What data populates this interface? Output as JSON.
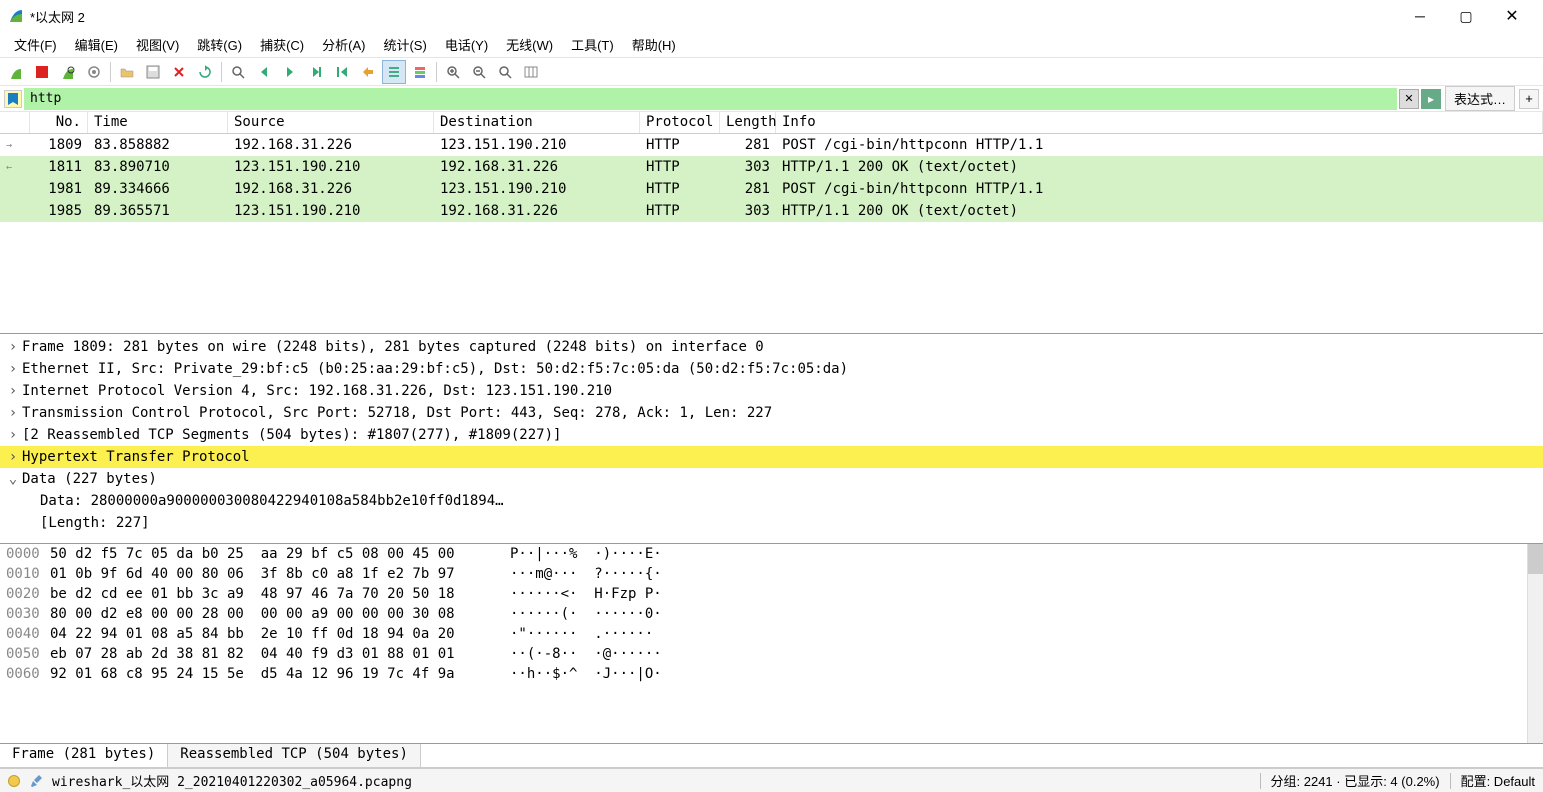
{
  "window": {
    "title": "*以太网 2"
  },
  "menu": {
    "file": "文件(F)",
    "edit": "编辑(E)",
    "view": "视图(V)",
    "go": "跳转(G)",
    "capture": "捕获(C)",
    "analyze": "分析(A)",
    "stats": "统计(S)",
    "telephony": "电话(Y)",
    "wireless": "无线(W)",
    "tools": "工具(T)",
    "help": "帮助(H)"
  },
  "filter": {
    "value": "http",
    "expression_btn": "表达式…",
    "plus_btn": "+"
  },
  "columns": {
    "no": "No.",
    "time": "Time",
    "src": "Source",
    "dst": "Destination",
    "proto": "Protocol",
    "len": "Length",
    "info": "Info"
  },
  "packets": [
    {
      "no": "1809",
      "time": "83.858882",
      "src": "192.168.31.226",
      "dst": "123.151.190.210",
      "proto": "HTTP",
      "len": "281",
      "info": "POST /cgi-bin/httpconn HTTP/1.1",
      "green": false,
      "mark": "→"
    },
    {
      "no": "1811",
      "time": "83.890710",
      "src": "123.151.190.210",
      "dst": "192.168.31.226",
      "proto": "HTTP",
      "len": "303",
      "info": "HTTP/1.1 200 OK  (text/octet)",
      "green": true,
      "mark": "←"
    },
    {
      "no": "1981",
      "time": "89.334666",
      "src": "192.168.31.226",
      "dst": "123.151.190.210",
      "proto": "HTTP",
      "len": "281",
      "info": "POST /cgi-bin/httpconn HTTP/1.1",
      "green": true,
      "mark": ""
    },
    {
      "no": "1985",
      "time": "89.365571",
      "src": "123.151.190.210",
      "dst": "192.168.31.226",
      "proto": "HTTP",
      "len": "303",
      "info": "HTTP/1.1 200 OK  (text/octet)",
      "green": true,
      "mark": ""
    }
  ],
  "details": [
    {
      "text": "Frame 1809: 281 bytes on wire (2248 bits), 281 bytes captured (2248 bits) on interface 0",
      "arrow": ">",
      "hl": false
    },
    {
      "text": "Ethernet II, Src: Private_29:bf:c5 (b0:25:aa:29:bf:c5), Dst: 50:d2:f5:7c:05:da (50:d2:f5:7c:05:da)",
      "arrow": ">",
      "hl": false
    },
    {
      "text": "Internet Protocol Version 4, Src: 192.168.31.226, Dst: 123.151.190.210",
      "arrow": ">",
      "hl": false
    },
    {
      "text": "Transmission Control Protocol, Src Port: 52718, Dst Port: 443, Seq: 278, Ack: 1, Len: 227",
      "arrow": ">",
      "hl": false
    },
    {
      "text": "[2 Reassembled TCP Segments (504 bytes): #1807(277), #1809(227)]",
      "arrow": ">",
      "hl": false
    },
    {
      "text": "Hypertext Transfer Protocol",
      "arrow": ">",
      "hl": true
    },
    {
      "text": "Data (227 bytes)",
      "arrow": "v",
      "hl": false
    }
  ],
  "details_children": [
    {
      "text": "Data: 28000000a900000030080422940108a584bb2e10ff0d1894…"
    },
    {
      "text": "[Length: 227]"
    }
  ],
  "hex": [
    {
      "off": "0000",
      "bytes": "50 d2 f5 7c 05 da b0 25  aa 29 bf c5 08 00 45 00",
      "ascii": "P··|···%  ·)····E·"
    },
    {
      "off": "0010",
      "bytes": "01 0b 9f 6d 40 00 80 06  3f 8b c0 a8 1f e2 7b 97",
      "ascii": "···m@···  ?·····{·"
    },
    {
      "off": "0020",
      "bytes": "be d2 cd ee 01 bb 3c a9  48 97 46 7a 70 20 50 18",
      "ascii": "······<·  H·Fzp P·"
    },
    {
      "off": "0030",
      "bytes": "80 00 d2 e8 00 00 28 00  00 00 a9 00 00 00 30 08",
      "ascii": "······(·  ······0·"
    },
    {
      "off": "0040",
      "bytes": "04 22 94 01 08 a5 84 bb  2e 10 ff 0d 18 94 0a 20",
      "ascii": "·\"······  .······ "
    },
    {
      "off": "0050",
      "bytes": "eb 07 28 ab 2d 38 81 82  04 40 f9 d3 01 88 01 01",
      "ascii": "··(·-8··  ·@······"
    },
    {
      "off": "0060",
      "bytes": "92 01 68 c8 95 24 15 5e  d5 4a 12 96 19 7c 4f 9a",
      "ascii": "··h··$·^  ·J···|O·"
    }
  ],
  "hex_tabs": {
    "frame": "Frame (281 bytes)",
    "reassembled": "Reassembled TCP (504 bytes)"
  },
  "status": {
    "file": "wireshark_以太网 2_20210401220302_a05964.pcapng",
    "packets": "分组: 2241  · 已显示: 4 (0.2%)",
    "profile": "配置: Default"
  }
}
